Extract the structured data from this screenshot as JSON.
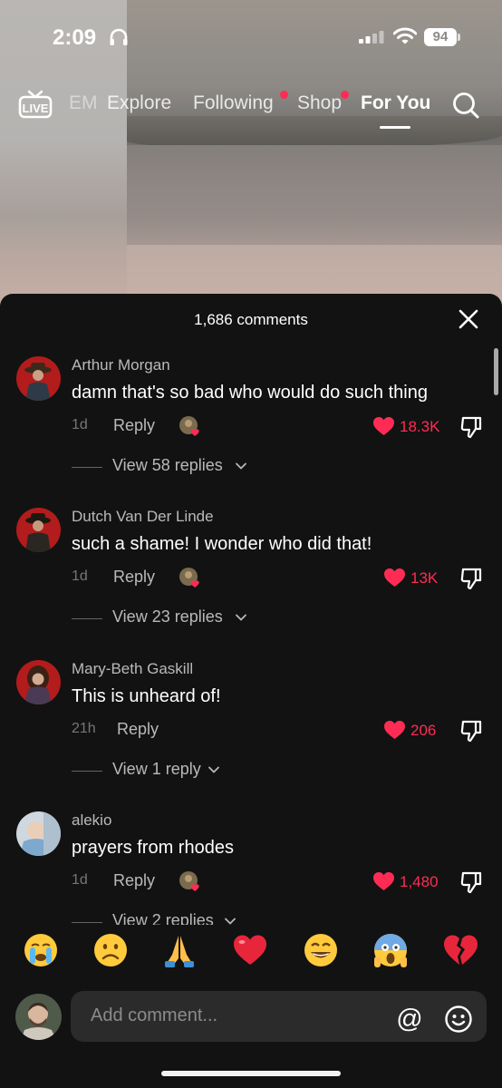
{
  "status_bar": {
    "time": "2:09",
    "battery": "94"
  },
  "top_nav": {
    "live_label": "LIVE",
    "items": [
      {
        "label": "EM",
        "active": false
      },
      {
        "label": "Explore",
        "active": false
      },
      {
        "label": "Following",
        "active": false,
        "dot": true
      },
      {
        "label": "Shop",
        "active": false,
        "dot": true
      },
      {
        "label": "For You",
        "active": true
      }
    ],
    "accent": "#fe2c55"
  },
  "sheet": {
    "title": "1,686 comments",
    "reply_label": "Reply",
    "comments": [
      {
        "user": "Arthur Morgan",
        "text": "damn that's so bad who would do such thing",
        "time": "1d",
        "likes": "18.3K",
        "creator_liked": true,
        "view_replies": "View 58 replies"
      },
      {
        "user": "Dutch Van Der Linde",
        "text": "such a shame! I wonder who did that!",
        "time": "1d",
        "likes": "13K",
        "creator_liked": true,
        "view_replies": "View 23 replies"
      },
      {
        "user": "Mary-Beth Gaskill",
        "text": "This is unheard of!",
        "time": "21h",
        "likes": "206",
        "creator_liked": false,
        "view_replies": "View 1 reply"
      },
      {
        "user": "alekio",
        "text": "prayers from rhodes",
        "time": "1d",
        "likes": "1,480",
        "creator_liked": true,
        "view_replies": "View 2 replies"
      }
    ]
  },
  "emoji_bar": [
    "😭",
    "☹️",
    "🙏",
    "❤️",
    "😄",
    "😱",
    "💔"
  ],
  "composer": {
    "placeholder": "Add comment...",
    "at_symbol": "@"
  }
}
